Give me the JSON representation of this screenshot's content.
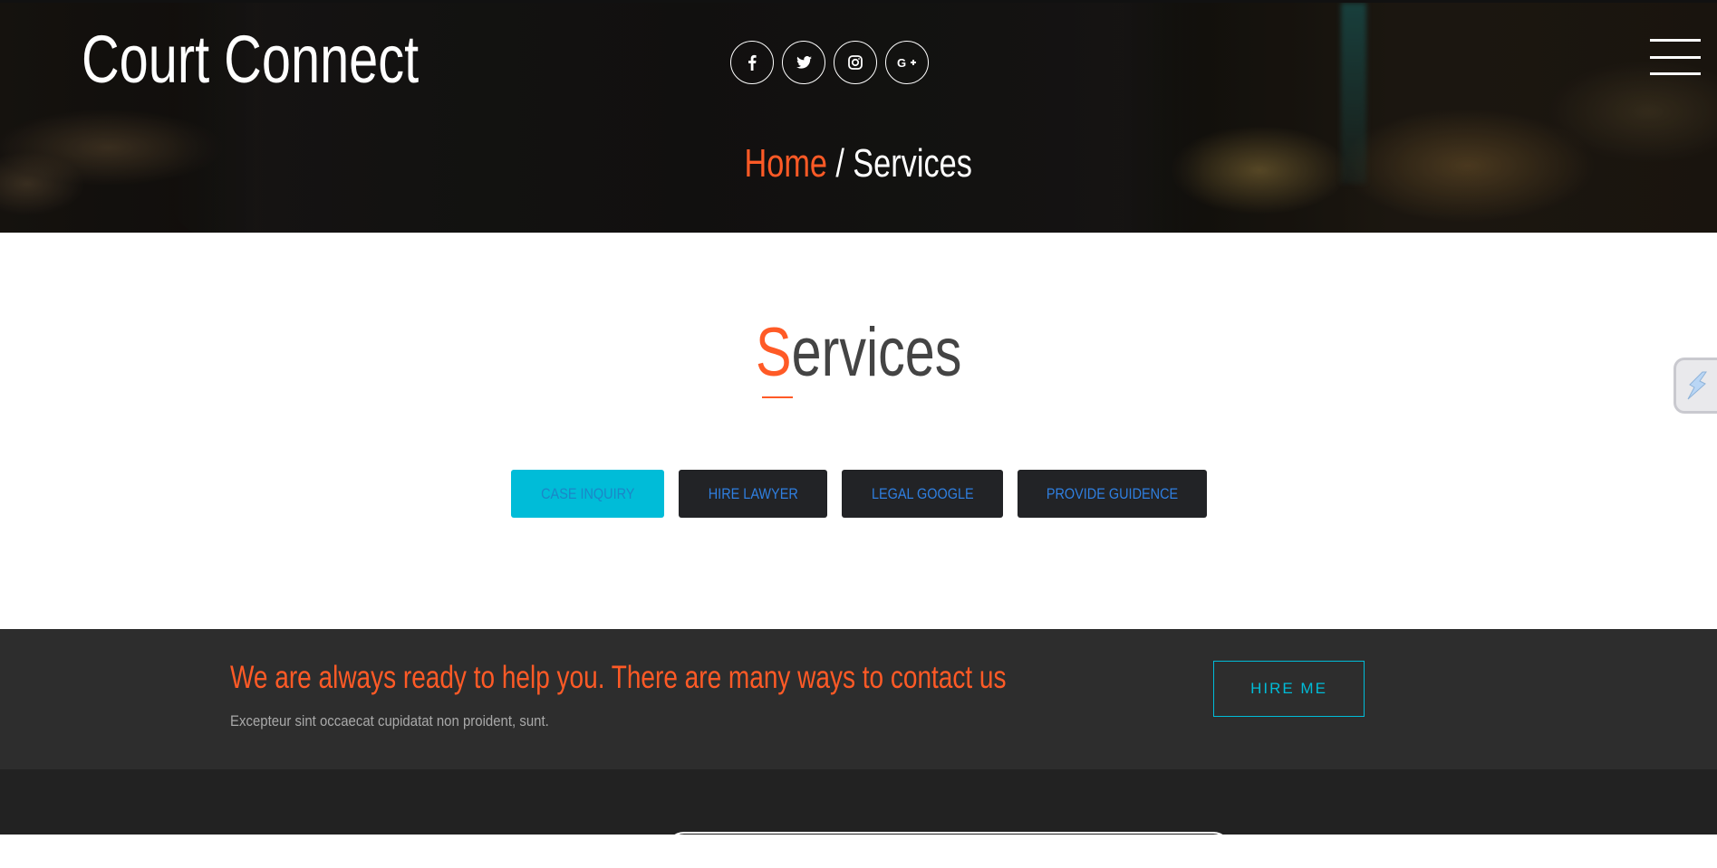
{
  "brand": {
    "title": "Court Connect"
  },
  "header": {
    "social": [
      {
        "icon": "facebook-icon",
        "glyph": "f"
      },
      {
        "icon": "twitter-icon",
        "glyph": "🐦"
      },
      {
        "icon": "instagram-icon",
        "glyph": "◎"
      },
      {
        "icon": "google-plus-icon",
        "glyph": "G+"
      }
    ],
    "menu_icon": "hamburger-menu-icon"
  },
  "breadcrumb": {
    "home": "Home",
    "separator": "/",
    "current": "Services"
  },
  "services": {
    "title_first_letter": "S",
    "title_rest": "ervices",
    "tabs": [
      {
        "label": "CASE INQUIRY",
        "active": true
      },
      {
        "label": "HIRE LAWYER",
        "active": false
      },
      {
        "label": "LEGAL GOOGLE",
        "active": false
      },
      {
        "label": "PROVIDE GUIDENCE",
        "active": false
      }
    ]
  },
  "contact": {
    "headline": "We are always ready to help you. There are many ways to contact us",
    "subtext": "Excepteur sint occaecat cupidatat non proident, sunt.",
    "button": "HIRE ME"
  },
  "colors": {
    "accent": "#ff5a26",
    "cyan": "#00bcd8",
    "tab_text": "#2f7fe0",
    "dark_band": "#2d2d2d",
    "footer": "#222222"
  }
}
